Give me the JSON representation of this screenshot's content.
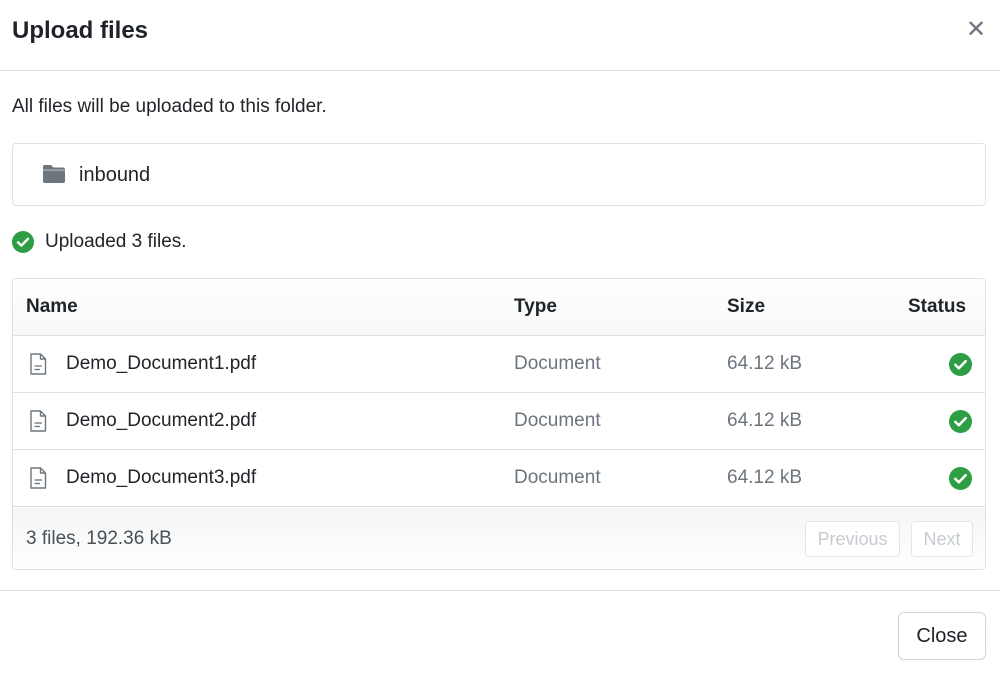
{
  "modal": {
    "title": "Upload files",
    "close_icon": "close-icon"
  },
  "intro_text": "All files will be uploaded to this folder.",
  "folder": {
    "icon": "folder-icon",
    "name": "inbound"
  },
  "status": {
    "icon": "check-circle-icon",
    "text": "Uploaded 3 files.",
    "color": "#2e9e45"
  },
  "table": {
    "columns": [
      "Name",
      "Type",
      "Size",
      "Status"
    ],
    "rows": [
      {
        "name": "Demo_Document1.pdf",
        "type": "Document",
        "size": "64.12 kB",
        "status_icon": "check-circle-icon"
      },
      {
        "name": "Demo_Document2.pdf",
        "type": "Document",
        "size": "64.12 kB",
        "status_icon": "check-circle-icon"
      },
      {
        "name": "Demo_Document3.pdf",
        "type": "Document",
        "size": "64.12 kB",
        "status_icon": "check-circle-icon"
      }
    ],
    "summary": "3 files, 192.36 kB",
    "pagination": {
      "previous_label": "Previous",
      "next_label": "Next"
    }
  },
  "footer": {
    "close_label": "Close"
  }
}
